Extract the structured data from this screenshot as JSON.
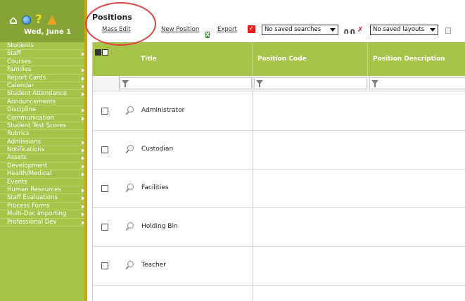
{
  "sidebar": {
    "date": "Wed, June 1",
    "items": [
      {
        "label": "Students",
        "has_arrow": false
      },
      {
        "label": "Staff",
        "has_arrow": true
      },
      {
        "label": "Courses",
        "has_arrow": false
      },
      {
        "label": "Families",
        "has_arrow": true
      },
      {
        "label": "Report Cards",
        "has_arrow": true
      },
      {
        "label": "Calendar",
        "has_arrow": true
      },
      {
        "label": "Student Attendance",
        "has_arrow": true
      },
      {
        "label": "Announcements",
        "has_arrow": false
      },
      {
        "label": "Discipline",
        "has_arrow": true
      },
      {
        "label": "Communication",
        "has_arrow": true
      },
      {
        "label": "Student Test Scores",
        "has_arrow": false
      },
      {
        "label": "Rubrics",
        "has_arrow": false
      },
      {
        "label": "Admissions",
        "has_arrow": true
      },
      {
        "label": "Notifications",
        "has_arrow": true
      },
      {
        "label": "Assets",
        "has_arrow": true
      },
      {
        "label": "Development",
        "has_arrow": true
      },
      {
        "label": "Health/Medical",
        "has_arrow": true
      },
      {
        "label": "Events",
        "has_arrow": false
      },
      {
        "label": "Human Resources",
        "has_arrow": true
      },
      {
        "label": "Staff Evaluations",
        "has_arrow": true
      },
      {
        "label": "Process Forms",
        "has_arrow": true
      },
      {
        "label": "Multi-Doc Importing",
        "has_arrow": true
      },
      {
        "label": "Professional Dev",
        "has_arrow": true
      }
    ]
  },
  "toolbar": {
    "title": "Positions",
    "mass_edit": "Mass Edit",
    "new_position": "New Position",
    "export": "Export",
    "saved_searches": "No saved searches",
    "saved_layouts": "No saved layouts"
  },
  "grid": {
    "columns": [
      "Title",
      "Position Code",
      "Position Description"
    ],
    "rows": [
      {
        "title": "Administrator"
      },
      {
        "title": "Custodian"
      },
      {
        "title": "Facilities"
      },
      {
        "title": "Holding Bin"
      },
      {
        "title": "Teacher"
      }
    ]
  },
  "colors": {
    "sidebar": "#a6c44a",
    "sidebar_header": "#86a436",
    "annotation": "#e34040"
  }
}
